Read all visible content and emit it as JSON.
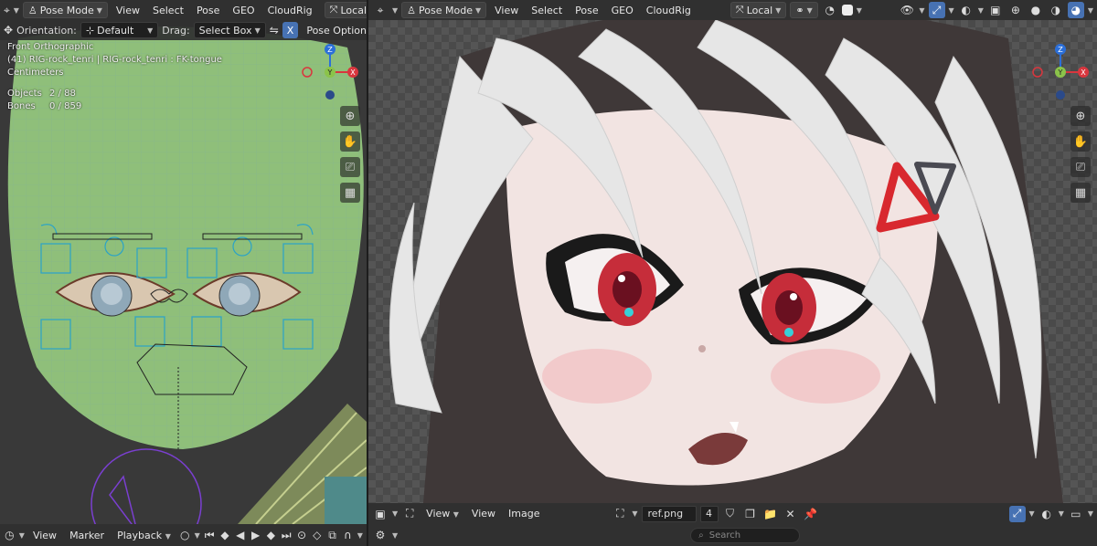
{
  "left_header": {
    "mode": "Pose Mode",
    "menus": [
      "View",
      "Select",
      "Pose",
      "GEO",
      "CloudRig"
    ],
    "transform_space": "Local",
    "orientation_label": "Orientation:",
    "orientation_value": "Default",
    "drag_label": "Drag:",
    "drag_value": "Select Box",
    "mirror_x": "X",
    "pose_options": "Pose Options"
  },
  "left_overlay": {
    "view_name": "Front Orthographic",
    "object_info": "(41) RIG-rock_tenri | RIG-rock_tenri : FK-tongue",
    "units": "Centimeters",
    "objects_label": "Objects",
    "objects_value": "2 / 88",
    "bones_label": "Bones",
    "bones_value": "0 / 859"
  },
  "right_header": {
    "mode": "Pose Mode",
    "menus": [
      "View",
      "Select",
      "Pose",
      "GEO",
      "CloudRig"
    ],
    "transform_space": "Local"
  },
  "gizmo": {
    "z": "Z",
    "y": "Y",
    "x": "X"
  },
  "image_editor": {
    "view_label": "View",
    "menus": [
      "View",
      "Image"
    ],
    "image_name": "ref.png",
    "users": "4"
  },
  "timeline": {
    "menus": [
      "View",
      "Marker",
      "Playback"
    ]
  },
  "status": {
    "search_placeholder": "Search"
  },
  "colors": {
    "accent": "#4772b3",
    "header_bg": "#303030",
    "mesh_green": "#8fbf7a"
  }
}
